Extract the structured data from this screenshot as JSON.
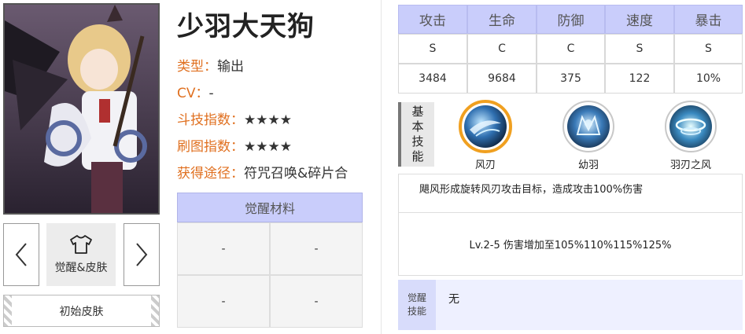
{
  "character": {
    "name": "少羽大天狗"
  },
  "info": {
    "type_key": "类型：",
    "type_val": "输出",
    "cv_key": "CV：",
    "cv_val": "-",
    "pvp_key": "斗技指数：",
    "pvp_val": "★★★★",
    "pve_key": "刷图指数：",
    "pve_val": "★★★★",
    "source_key": "获得途径：",
    "source_val": "符咒召唤&碎片合"
  },
  "awaken_materials": {
    "header": "觉醒材料",
    "cells": [
      "-",
      "-",
      "-",
      "-"
    ]
  },
  "buttons": {
    "skin_label": "觉醒&皮肤",
    "initial_skin": "初始皮肤"
  },
  "stats": {
    "headers": [
      "攻击",
      "生命",
      "防御",
      "速度",
      "暴击"
    ],
    "grades": [
      "S",
      "C",
      "C",
      "S",
      "S"
    ],
    "values": [
      "3484",
      "9684",
      "375",
      "122",
      "10%"
    ]
  },
  "skills": {
    "tag": "基本技能",
    "items": [
      {
        "name": "风刃",
        "selected": true,
        "icon": "wind-blade-icon"
      },
      {
        "name": "幼羽",
        "selected": false,
        "icon": "young-feather-icon"
      },
      {
        "name": "羽刃之风",
        "selected": false,
        "icon": "feather-wind-icon"
      }
    ],
    "description": "飓风形成旋转风刃攻击目标，造成攻击100%伤害",
    "levels": "Lv.2-5 伤害增加至105%110%115%125%"
  },
  "awaken_skill": {
    "label": "觉醒技能",
    "value": "无"
  },
  "colors": {
    "accent_orange": "#e07020",
    "header_blue": "#c9cdfb",
    "selected_ring": "#f0a020"
  }
}
